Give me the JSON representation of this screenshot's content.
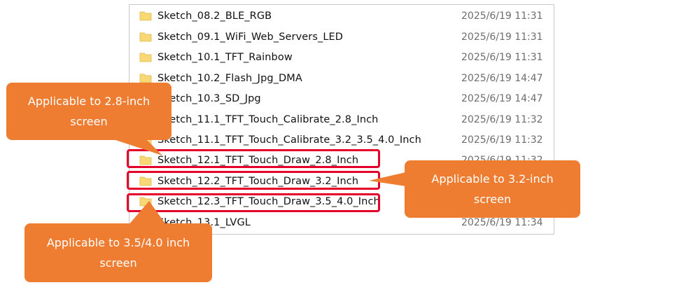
{
  "files": [
    {
      "name": "Sketch_08.2_BLE_RGB",
      "date": "2025/6/19 11:31"
    },
    {
      "name": "Sketch_09.1_WiFi_Web_Servers_LED",
      "date": "2025/6/19 11:31"
    },
    {
      "name": "Sketch_10.1_TFT_Rainbow",
      "date": "2025/6/19 11:31"
    },
    {
      "name": "Sketch_10.2_Flash_Jpg_DMA",
      "date": "2025/6/19 14:47"
    },
    {
      "name": "Sketch_10.3_SD_Jpg",
      "date": "2025/6/19 14:47"
    },
    {
      "name": "Sketch_11.1_TFT_Touch_Calibrate_2.8_Inch",
      "date": "2025/6/19 11:32"
    },
    {
      "name": "Sketch_11.1_TFT_Touch_Calibrate_3.2_3.5_4.0_Inch",
      "date": "2025/6/19 11:32"
    },
    {
      "name": "Sketch_12.1_TFT_Touch_Draw_2.8_Inch",
      "date": "2025/6/19 11:32"
    },
    {
      "name": "Sketch_12.2_TFT_Touch_Draw_3.2_Inch",
      "date": ""
    },
    {
      "name": "Sketch_12.3_TFT_Touch_Draw_3.5_4.0_Inch",
      "date": ""
    },
    {
      "name": "Sketch_13.1_LVGL",
      "date": "2025/6/19 11:34"
    }
  ],
  "callouts": {
    "c28": {
      "line1": "Applicable to 2.8-inch",
      "line2": "screen"
    },
    "c32": {
      "line1": "Applicable to 3.2-inch",
      "line2": "screen"
    },
    "c354": {
      "line1": "Applicable to 3.5/4.0 inch",
      "line2": "screen"
    }
  },
  "colors": {
    "callout": "#ee7d31",
    "highlight": "#e4002b",
    "folder": "#f8d775"
  },
  "icons": {
    "folder": "folder-icon"
  }
}
